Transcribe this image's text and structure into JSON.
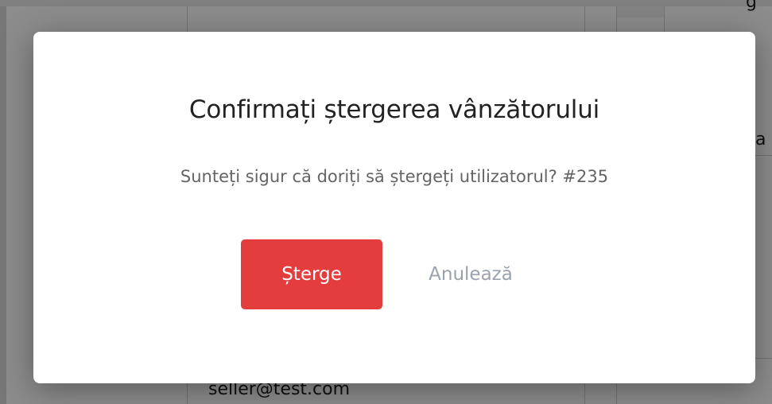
{
  "background": {
    "table_cells": {
      "email": "seller@test.com",
      "partial_right_text": "a",
      "partial_top_right_text": "g"
    }
  },
  "modal": {
    "title": "Confirmați ștergerea vânzătorului",
    "message": "Sunteți sigur că doriți să ștergeți utilizatorul? #235",
    "delete_label": "Șterge",
    "cancel_label": "Anulează"
  },
  "colors": {
    "delete_button": "#e43d3d",
    "cancel_text": "#9aa2ad",
    "overlay": "rgba(0,0,0,0.45)"
  }
}
